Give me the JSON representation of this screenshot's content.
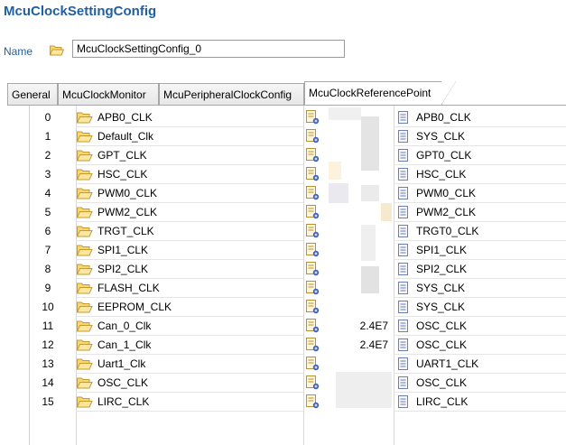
{
  "header": {
    "title": "McuClockSettingConfig"
  },
  "name_field": {
    "label": "Name",
    "value": "McuClockSettingConfig_0",
    "icon": "folder-icon"
  },
  "tabs": [
    {
      "label": "General"
    },
    {
      "label": "McuClockMonitor"
    },
    {
      "label": "McuPeripheralClockConfig"
    },
    {
      "label": "McuClockReferencePoint",
      "active": true
    }
  ],
  "rows": [
    {
      "index": "0",
      "name": "APB0_CLK",
      "value": "",
      "ref": "APB0_CLK"
    },
    {
      "index": "1",
      "name": "Default_Clk",
      "value": "",
      "ref": "SYS_CLK"
    },
    {
      "index": "2",
      "name": "GPT_CLK",
      "value": "",
      "ref": "GPT0_CLK"
    },
    {
      "index": "3",
      "name": "HSC_CLK",
      "value": "",
      "ref": "HSC_CLK"
    },
    {
      "index": "4",
      "name": "PWM0_CLK",
      "value": "",
      "ref": "PWM0_CLK"
    },
    {
      "index": "5",
      "name": "PWM2_CLK",
      "value": "",
      "ref": "PWM2_CLK"
    },
    {
      "index": "6",
      "name": "TRGT_CLK",
      "value": "",
      "ref": "TRGT0_CLK"
    },
    {
      "index": "7",
      "name": "SPI1_CLK",
      "value": "",
      "ref": "SPI1_CLK"
    },
    {
      "index": "8",
      "name": "SPI2_CLK",
      "value": "",
      "ref": "SPI2_CLK"
    },
    {
      "index": "9",
      "name": "FLASH_CLK",
      "value": "",
      "ref": "SYS_CLK"
    },
    {
      "index": "10",
      "name": "EEPROM_CLK",
      "value": "",
      "ref": "SYS_CLK"
    },
    {
      "index": "11",
      "name": "Can_0_Clk",
      "value": "2.4E7",
      "ref": "OSC_CLK"
    },
    {
      "index": "12",
      "name": "Can_1_Clk",
      "value": "2.4E7",
      "ref": "OSC_CLK"
    },
    {
      "index": "13",
      "name": "Uart1_Clk",
      "value": "",
      "ref": "UART1_CLK"
    },
    {
      "index": "14",
      "name": "OSC_CLK",
      "value": "",
      "ref": "OSC_CLK"
    },
    {
      "index": "15",
      "name": "LIRC_CLK",
      "value": "",
      "ref": "LIRC_CLK"
    }
  ]
}
